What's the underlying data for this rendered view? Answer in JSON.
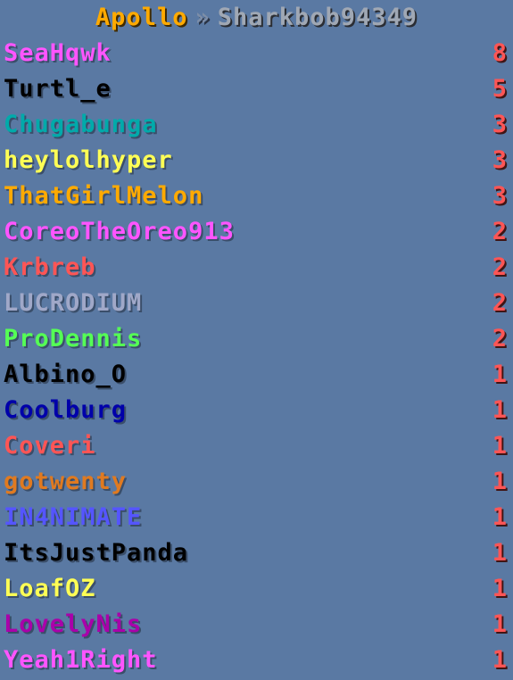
{
  "header": {
    "server": "Apollo",
    "separator": "»",
    "player": "Sharkbob94349"
  },
  "colors": {
    "background": "#5a79a3",
    "score": "#ff5555",
    "server": "#ffaa00"
  },
  "leaderboard": [
    {
      "name": "SeaHqwk",
      "score": "8",
      "color": "#ff55ff"
    },
    {
      "name": "Turtl_e",
      "score": "5",
      "color": "#000000"
    },
    {
      "name": "Chugabunga",
      "score": "3",
      "color": "#00aaaa"
    },
    {
      "name": "heylolhyper",
      "score": "3",
      "color": "#ffff55"
    },
    {
      "name": "ThatGirlMelon",
      "score": "3",
      "color": "#ffaa00"
    },
    {
      "name": "CoreoTheOreo913",
      "score": "2",
      "color": "#ff55ff"
    },
    {
      "name": "Krbreb",
      "score": "2",
      "color": "#ff5555"
    },
    {
      "name": "LUCRODIUM",
      "score": "2",
      "color": "#a0a8c8"
    },
    {
      "name": "ProDennis",
      "score": "2",
      "color": "#55ff55"
    },
    {
      "name": "Albino_O",
      "score": "1",
      "color": "#000000"
    },
    {
      "name": "Coolburg",
      "score": "1",
      "color": "#0000aa"
    },
    {
      "name": "Coveri",
      "score": "1",
      "color": "#ff5555"
    },
    {
      "name": "gotwenty",
      "score": "1",
      "color": "#e07a20"
    },
    {
      "name": "IN4NIMATE",
      "score": "1",
      "color": "#5555ff"
    },
    {
      "name": "ItsJustPanda",
      "score": "1",
      "color": "#000000"
    },
    {
      "name": "LoafOZ",
      "score": "1",
      "color": "#ffff55"
    },
    {
      "name": "LovelyNis",
      "score": "1",
      "color": "#aa00aa"
    },
    {
      "name": "Yeah1Right",
      "score": "1",
      "color": "#ff55ff"
    }
  ]
}
